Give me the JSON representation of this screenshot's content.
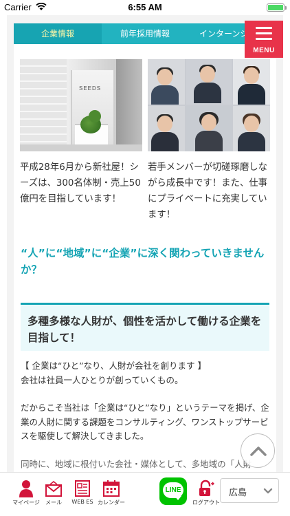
{
  "status_bar": {
    "carrier": "Carrier",
    "time": "6:55 AM",
    "battery_level": 1.0
  },
  "tabs": [
    {
      "label": "企業情報",
      "active": true
    },
    {
      "label": "前年採用情報",
      "active": false
    },
    {
      "label": "インターンシ",
      "active": false
    }
  ],
  "menu_button": {
    "label": "MENU",
    "color": "#e8334a"
  },
  "photos": {
    "office_sign": "SEEDS"
  },
  "captions": {
    "left": "平成28年6月から新社屋！シーズは、300名体制・売上50億円を目指しています！",
    "right": "若手メンバーが切磋琢磨しながら成長中です！また、仕事にプライベートに充実しています！"
  },
  "headline": "“人”に“地域”に“企業”に深く関わっていきませんか？",
  "feature_heading": "多種多様な人財が、個性を活かして働ける企業を目指して！",
  "body": {
    "p1_line1": "【 企業は“ひと”なり、人財が会社を創ります 】",
    "p1_line2": "会社は社員一人ひとりが創っていくもの。",
    "p2": "だからこそ当社は「企業は“ひと”なり」というテーマを掲げ、企業の人財に関する課題をコンサルティング、ワンストップサービスを駆使して解決してきました。",
    "p3": "同時に、地域に根付いた会社・媒体として、多地域の「人財"
  },
  "bottom_nav": {
    "items": [
      {
        "label": "マイページ",
        "icon": "person-icon"
      },
      {
        "label": "メール",
        "icon": "mail-icon"
      },
      {
        "label": "WEB ES",
        "icon": "document-icon"
      },
      {
        "label": "カレンダー",
        "icon": "calendar-icon"
      },
      {
        "label": "LINE",
        "icon": "line-icon"
      },
      {
        "label": "ログアウト",
        "icon": "logout-lock-icon"
      }
    ],
    "region": "広島"
  },
  "colors": {
    "accent_teal": "#15a4b4",
    "nav_red": "#d2143a",
    "line_green": "#00c300"
  }
}
